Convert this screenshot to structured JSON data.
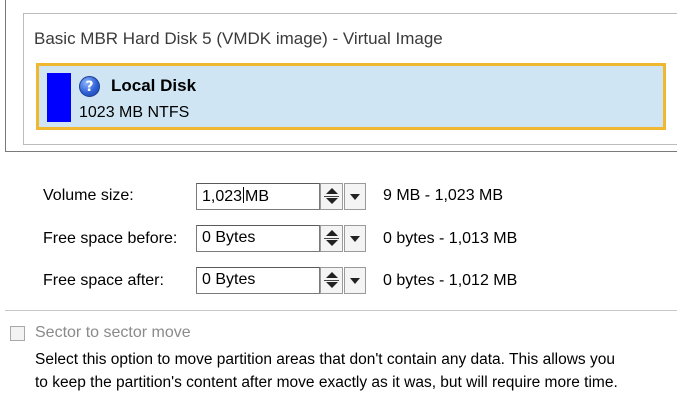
{
  "disk": {
    "title": "Basic MBR Hard Disk 5 (VMDK image) - Virtual Image",
    "partition": {
      "label": "Local Disk",
      "info": "1023 MB NTFS",
      "color": "#0000ff",
      "icon": "help-icon"
    }
  },
  "fields": {
    "volume_size": {
      "label": "Volume size:",
      "value_number": "1,023",
      "value_unit": "MB",
      "range": "9 MB - 1,023 MB"
    },
    "free_before": {
      "label": "Free space before:",
      "value": "0 Bytes",
      "range": "0 bytes - 1,013 MB"
    },
    "free_after": {
      "label": "Free space after:",
      "value": "0 Bytes",
      "range": "0 bytes - 1,012 MB"
    }
  },
  "sector_move": {
    "label": "Sector to sector move",
    "checked": false,
    "description_line1": "Select this option to move partition areas that don't contain any data. This allows you",
    "description_line2": "to keep the partition's content after move exactly as it was, but will require more time."
  },
  "colors": {
    "partition_border": "#f0b730",
    "partition_bg": "#cfe5f3",
    "disabled_text": "#8a8a8a"
  }
}
